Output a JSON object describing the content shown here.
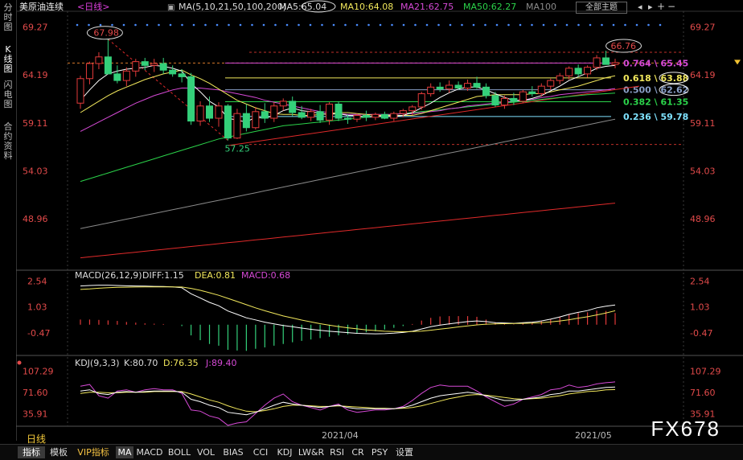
{
  "sidebar": [
    {
      "label": "分时图",
      "active": false
    },
    {
      "label": "K线图",
      "active": true
    },
    {
      "label": "闪电图",
      "active": false
    },
    {
      "label": "合约资料",
      "active": false
    }
  ],
  "header": {
    "title": "美原油连续",
    "period": "<日线>",
    "ma_params": "MA(5,10,21,50,100,200)",
    "ma5": "MA5:65.04",
    "ma10": "MA10:64.08",
    "ma21": "MA21:62.75",
    "ma50": "MA50:62.27",
    "ma100": "MA100",
    "theme_button": "全部主题"
  },
  "colors": {
    "up": "#e23a3a",
    "down": "#34d07a",
    "ma5": "#ffffff",
    "ma10": "#f2e85c",
    "ma21": "#d64ad6",
    "ma50": "#2bd34a",
    "ma100": "#8a8a8a",
    "ma200": "#e02a2a"
  },
  "price_axis": {
    "ticks": [
      "69.27",
      "64.19",
      "59.11",
      "54.03",
      "48.96"
    ]
  },
  "annotations": {
    "high": "67.98",
    "recent_high": "66.76",
    "low": "57.25"
  },
  "fib_levels": [
    {
      "label": "0.764",
      "value": "65.45",
      "color": "#d64ad6"
    },
    {
      "label": "0.618",
      "value": "63.88",
      "color": "#f2e85c"
    },
    {
      "label": "0.500",
      "value": "62.62",
      "color": "#8aa0c8"
    },
    {
      "label": "0.382",
      "value": "61.35",
      "color": "#2bd34a"
    },
    {
      "label": "0.236",
      "value": "59.78",
      "color": "#7fe3ff"
    }
  ],
  "candles": [
    {
      "o": 61.2,
      "h": 64.1,
      "l": 60.6,
      "c": 63.8
    },
    {
      "o": 63.8,
      "h": 65.6,
      "l": 63.2,
      "c": 65.4
    },
    {
      "o": 65.4,
      "h": 66.6,
      "l": 64.8,
      "c": 66.1
    },
    {
      "o": 66.1,
      "h": 67.98,
      "l": 65.2,
      "c": 64.3
    },
    {
      "o": 64.3,
      "h": 65.2,
      "l": 63.3,
      "c": 63.6
    },
    {
      "o": 63.6,
      "h": 65.0,
      "l": 63.0,
      "c": 64.6
    },
    {
      "o": 64.6,
      "h": 65.9,
      "l": 64.0,
      "c": 65.6
    },
    {
      "o": 65.6,
      "h": 66.0,
      "l": 64.7,
      "c": 65.2
    },
    {
      "o": 65.2,
      "h": 65.9,
      "l": 64.5,
      "c": 65.4
    },
    {
      "o": 65.4,
      "h": 66.0,
      "l": 64.3,
      "c": 64.7
    },
    {
      "o": 64.7,
      "h": 65.2,
      "l": 64.0,
      "c": 64.3
    },
    {
      "o": 64.3,
      "h": 64.8,
      "l": 63.4,
      "c": 64.0
    },
    {
      "o": 64.0,
      "h": 64.4,
      "l": 58.9,
      "c": 59.3
    },
    {
      "o": 59.3,
      "h": 61.4,
      "l": 58.8,
      "c": 60.9
    },
    {
      "o": 60.9,
      "h": 61.9,
      "l": 59.2,
      "c": 59.6
    },
    {
      "o": 59.6,
      "h": 61.3,
      "l": 58.7,
      "c": 60.9
    },
    {
      "o": 60.9,
      "h": 61.1,
      "l": 57.25,
      "c": 57.5
    },
    {
      "o": 57.5,
      "h": 60.6,
      "l": 57.4,
      "c": 60.1
    },
    {
      "o": 60.1,
      "h": 61.1,
      "l": 58.2,
      "c": 58.6
    },
    {
      "o": 58.6,
      "h": 60.8,
      "l": 58.4,
      "c": 60.3
    },
    {
      "o": 60.3,
      "h": 61.2,
      "l": 59.1,
      "c": 59.6
    },
    {
      "o": 59.6,
      "h": 61.3,
      "l": 59.2,
      "c": 60.9
    },
    {
      "o": 60.9,
      "h": 61.7,
      "l": 60.4,
      "c": 61.4
    },
    {
      "o": 61.4,
      "h": 61.9,
      "l": 59.8,
      "c": 60.2
    },
    {
      "o": 60.2,
      "h": 60.9,
      "l": 59.5,
      "c": 59.7
    },
    {
      "o": 59.7,
      "h": 60.6,
      "l": 59.3,
      "c": 60.3
    },
    {
      "o": 60.3,
      "h": 61.0,
      "l": 59.1,
      "c": 59.4
    },
    {
      "o": 59.4,
      "h": 61.3,
      "l": 58.9,
      "c": 61.1
    },
    {
      "o": 61.1,
      "h": 61.4,
      "l": 59.3,
      "c": 59.6
    },
    {
      "o": 59.6,
      "h": 60.0,
      "l": 59.0,
      "c": 59.5
    },
    {
      "o": 59.5,
      "h": 60.1,
      "l": 59.2,
      "c": 59.9
    },
    {
      "o": 59.9,
      "h": 60.4,
      "l": 59.3,
      "c": 59.7
    },
    {
      "o": 59.7,
      "h": 60.2,
      "l": 59.4,
      "c": 60.0
    },
    {
      "o": 60.0,
      "h": 60.3,
      "l": 59.5,
      "c": 59.6
    },
    {
      "o": 59.6,
      "h": 60.3,
      "l": 59.3,
      "c": 60.1
    },
    {
      "o": 60.1,
      "h": 60.6,
      "l": 59.7,
      "c": 60.4
    },
    {
      "o": 60.4,
      "h": 61.0,
      "l": 59.9,
      "c": 60.8
    },
    {
      "o": 60.8,
      "h": 62.4,
      "l": 60.5,
      "c": 62.2
    },
    {
      "o": 62.2,
      "h": 63.3,
      "l": 61.9,
      "c": 62.9
    },
    {
      "o": 62.9,
      "h": 63.4,
      "l": 62.4,
      "c": 62.7
    },
    {
      "o": 62.7,
      "h": 63.6,
      "l": 62.3,
      "c": 63.1
    },
    {
      "o": 63.1,
      "h": 63.5,
      "l": 62.6,
      "c": 62.8
    },
    {
      "o": 62.8,
      "h": 63.7,
      "l": 62.5,
      "c": 63.3
    },
    {
      "o": 63.3,
      "h": 64.0,
      "l": 62.7,
      "c": 62.9
    },
    {
      "o": 62.9,
      "h": 63.3,
      "l": 61.7,
      "c": 62.0
    },
    {
      "o": 62.0,
      "h": 62.4,
      "l": 60.8,
      "c": 61.0
    },
    {
      "o": 61.0,
      "h": 62.0,
      "l": 60.6,
      "c": 61.7
    },
    {
      "o": 61.7,
      "h": 62.3,
      "l": 61.0,
      "c": 61.4
    },
    {
      "o": 61.4,
      "h": 62.6,
      "l": 61.2,
      "c": 62.4
    },
    {
      "o": 62.4,
      "h": 63.0,
      "l": 61.9,
      "c": 62.2
    },
    {
      "o": 62.2,
      "h": 63.3,
      "l": 61.9,
      "c": 63.0
    },
    {
      "o": 63.0,
      "h": 63.8,
      "l": 62.6,
      "c": 63.6
    },
    {
      "o": 63.6,
      "h": 64.4,
      "l": 63.2,
      "c": 64.1
    },
    {
      "o": 64.1,
      "h": 65.1,
      "l": 63.7,
      "c": 64.9
    },
    {
      "o": 64.9,
      "h": 65.3,
      "l": 64.0,
      "c": 64.3
    },
    {
      "o": 64.3,
      "h": 65.2,
      "l": 63.9,
      "c": 65.0
    },
    {
      "o": 65.0,
      "h": 66.3,
      "l": 64.7,
      "c": 66.0
    },
    {
      "o": 66.0,
      "h": 66.76,
      "l": 65.6,
      "c": 65.3
    },
    {
      "o": 65.3,
      "h": 65.9,
      "l": 64.9,
      "c": 65.5
    }
  ],
  "ma_lines": {
    "ma5": [
      61.5,
      62.6,
      63.6,
      64.3,
      64.6,
      64.8,
      64.9,
      65.0,
      65.2,
      65.1,
      64.9,
      64.6,
      63.3,
      62.4,
      61.4,
      60.8,
      59.6,
      59.4,
      59.2,
      59.7,
      59.6,
      59.9,
      60.4,
      60.7,
      60.4,
      60.3,
      60.1,
      60.0,
      60.1,
      59.9,
      59.9,
      59.7,
      59.8,
      59.8,
      59.8,
      59.9,
      60.2,
      60.7,
      61.2,
      61.8,
      62.3,
      62.7,
      62.9,
      62.9,
      62.6,
      62.2,
      61.8,
      61.5,
      61.5,
      61.7,
      62.0,
      62.5,
      63.0,
      63.6,
      64.0,
      64.4,
      64.9,
      65.1,
      65.2
    ],
    "ma10": [
      60.2,
      60.8,
      61.4,
      62.0,
      62.5,
      62.9,
      63.3,
      63.7,
      64.0,
      64.3,
      64.5,
      64.7,
      64.2,
      63.8,
      63.3,
      62.7,
      62.1,
      61.5,
      61.1,
      60.7,
      60.4,
      60.1,
      60.0,
      60.0,
      59.9,
      59.9,
      60.0,
      60.1,
      60.2,
      60.2,
      60.1,
      60.0,
      59.9,
      59.9,
      59.9,
      59.9,
      59.9,
      60.1,
      60.4,
      60.7,
      61.0,
      61.3,
      61.6,
      61.9,
      62.0,
      62.1,
      62.1,
      62.1,
      62.1,
      62.2,
      62.2,
      62.4,
      62.6,
      62.8,
      63.0,
      63.3,
      63.6,
      63.9,
      64.1
    ],
    "ma21": [
      58.2,
      58.7,
      59.2,
      59.7,
      60.2,
      60.7,
      61.2,
      61.6,
      62.0,
      62.3,
      62.6,
      62.8,
      62.8,
      62.8,
      62.7,
      62.6,
      62.4,
      62.2,
      62.0,
      61.8,
      61.5,
      61.3,
      61.1,
      60.9,
      60.7,
      60.5,
      60.3,
      60.2,
      60.1,
      60.0,
      60.0,
      60.0,
      60.0,
      60.0,
      60.0,
      60.1,
      60.1,
      60.2,
      60.3,
      60.4,
      60.6,
      60.7,
      60.9,
      61.0,
      61.1,
      61.2,
      61.3,
      61.4,
      61.5,
      61.6,
      61.8,
      61.9,
      62.1,
      62.2,
      62.3,
      62.4,
      62.5,
      62.6,
      62.75
    ],
    "ma50": [
      52.9,
      53.2,
      53.5,
      53.8,
      54.1,
      54.4,
      54.7,
      55.0,
      55.3,
      55.6,
      55.9,
      56.2,
      56.5,
      56.8,
      57.1,
      57.4,
      57.6,
      57.8,
      58.0,
      58.2,
      58.4,
      58.6,
      58.8,
      58.9,
      59.0,
      59.1,
      59.2,
      59.3,
      59.4,
      59.5,
      59.6,
      59.7,
      59.8,
      59.9,
      60.0,
      60.1,
      60.2,
      60.3,
      60.4,
      60.5,
      60.6,
      60.7,
      60.8,
      60.9,
      61.0,
      61.1,
      61.2,
      61.3,
      61.4,
      61.5,
      61.6,
      61.7,
      61.8,
      61.9,
      62.0,
      62.1,
      62.15,
      62.2,
      62.27
    ],
    "ma100": [
      47.9,
      48.1,
      48.3,
      48.5,
      48.7,
      48.9,
      49.1,
      49.3,
      49.5,
      49.7,
      49.9,
      50.1,
      50.3,
      50.5,
      50.7,
      50.9,
      51.1,
      51.3,
      51.5,
      51.7,
      51.9,
      52.1,
      52.3,
      52.5,
      52.7,
      52.9,
      53.1,
      53.3,
      53.5,
      53.7,
      53.9,
      54.1,
      54.3,
      54.5,
      54.7,
      54.9,
      55.1,
      55.3,
      55.5,
      55.7,
      55.9,
      56.1,
      56.3,
      56.5,
      56.7,
      56.9,
      57.1,
      57.3,
      57.5,
      57.7,
      57.9,
      58.1,
      58.3,
      58.5,
      58.7,
      58.9,
      59.1,
      59.3,
      59.5
    ],
    "ma200": [
      44.8,
      44.9,
      45.0,
      45.1,
      45.2,
      45.3,
      45.4,
      45.5,
      45.6,
      45.7,
      45.8,
      45.9,
      46.0,
      46.1,
      46.2,
      46.3,
      46.4,
      46.5,
      46.6,
      46.7,
      46.8,
      46.9,
      47.0,
      47.1,
      47.2,
      47.3,
      47.4,
      47.5,
      47.6,
      47.7,
      47.8,
      47.9,
      48.0,
      48.1,
      48.2,
      48.3,
      48.4,
      48.5,
      48.6,
      48.7,
      48.8,
      48.9,
      49.0,
      49.1,
      49.2,
      49.3,
      49.4,
      49.5,
      49.6,
      49.7,
      49.8,
      49.9,
      50.0,
      50.1,
      50.2,
      50.3,
      50.4,
      50.5,
      50.6
    ]
  },
  "macd": {
    "params": "MACD(26,12,9)",
    "diff": "DIFF:1.15",
    "dea": "DEA:0.81",
    "macd": "MACD:0.68",
    "axis": [
      "2.54",
      "1.03",
      "-0.47"
    ],
    "diff_series": [
      2.25,
      2.28,
      2.3,
      2.3,
      2.28,
      2.26,
      2.25,
      2.24,
      2.23,
      2.22,
      2.2,
      2.15,
      1.8,
      1.55,
      1.3,
      1.1,
      0.8,
      0.6,
      0.4,
      0.28,
      0.15,
      0.05,
      -0.05,
      -0.12,
      -0.2,
      -0.27,
      -0.33,
      -0.38,
      -0.42,
      -0.46,
      -0.5,
      -0.52,
      -0.53,
      -0.52,
      -0.49,
      -0.45,
      -0.38,
      -0.25,
      -0.12,
      -0.02,
      0.05,
      0.12,
      0.18,
      0.22,
      0.18,
      0.12,
      0.1,
      0.08,
      0.12,
      0.15,
      0.22,
      0.32,
      0.45,
      0.6,
      0.72,
      0.82,
      0.98,
      1.08,
      1.15
    ],
    "dea_series": [
      2.05,
      2.08,
      2.12,
      2.15,
      2.17,
      2.18,
      2.19,
      2.2,
      2.2,
      2.2,
      2.2,
      2.19,
      2.11,
      2.0,
      1.86,
      1.71,
      1.53,
      1.35,
      1.16,
      0.98,
      0.81,
      0.66,
      0.51,
      0.39,
      0.27,
      0.16,
      0.06,
      -0.03,
      -0.11,
      -0.18,
      -0.24,
      -0.3,
      -0.34,
      -0.38,
      -0.4,
      -0.41,
      -0.4,
      -0.37,
      -0.32,
      -0.26,
      -0.2,
      -0.13,
      -0.07,
      -0.01,
      0.03,
      0.05,
      0.06,
      0.07,
      0.08,
      0.09,
      0.12,
      0.16,
      0.22,
      0.29,
      0.38,
      0.46,
      0.57,
      0.68,
      0.81
    ],
    "hist": [
      0.3,
      0.3,
      0.28,
      0.25,
      0.22,
      0.16,
      0.12,
      0.08,
      0.06,
      0.04,
      0.0,
      -0.08,
      -0.62,
      -0.9,
      -1.12,
      -1.22,
      -1.46,
      -1.5,
      -1.52,
      -1.4,
      -1.32,
      -1.22,
      -1.12,
      -1.02,
      -0.94,
      -0.86,
      -0.78,
      -0.7,
      -0.62,
      -0.56,
      -0.52,
      -0.44,
      -0.38,
      -0.28,
      -0.18,
      -0.08,
      0.04,
      0.24,
      0.4,
      0.48,
      0.5,
      0.5,
      0.5,
      0.46,
      0.3,
      0.14,
      0.08,
      0.02,
      0.08,
      0.12,
      0.2,
      0.32,
      0.46,
      0.62,
      0.68,
      0.72,
      0.82,
      0.8,
      0.68
    ]
  },
  "kdj": {
    "params": "KDJ(9,3,3)",
    "k": "K:80.70",
    "d": "D:76.35",
    "j": "J:89.40",
    "axis": [
      "107.29",
      "71.60",
      "35.91"
    ],
    "k_series": [
      74,
      76,
      70,
      68,
      72,
      73,
      72,
      73,
      74,
      74,
      74,
      72,
      60,
      56,
      50,
      46,
      38,
      36,
      34,
      38,
      44,
      50,
      55,
      52,
      50,
      48,
      46,
      48,
      50,
      46,
      44,
      44,
      44,
      44,
      44,
      46,
      50,
      56,
      62,
      66,
      68,
      70,
      72,
      70,
      66,
      62,
      58,
      58,
      60,
      62,
      64,
      68,
      70,
      74,
      74,
      76,
      78,
      80,
      80.7
    ],
    "d_series": [
      70,
      72,
      72,
      71,
      71,
      72,
      72,
      72,
      73,
      73,
      73,
      73,
      69,
      64,
      59,
      55,
      49,
      44,
      40,
      39,
      41,
      44,
      48,
      50,
      50,
      49,
      48,
      48,
      49,
      48,
      47,
      46,
      45,
      45,
      44,
      45,
      46,
      49,
      53,
      57,
      61,
      64,
      67,
      68,
      67,
      65,
      63,
      61,
      60,
      61,
      62,
      64,
      66,
      69,
      71,
      73,
      74,
      76,
      76.35
    ],
    "j_series": [
      82,
      85,
      66,
      62,
      74,
      76,
      72,
      76,
      78,
      76,
      76,
      70,
      42,
      40,
      32,
      28,
      16,
      20,
      22,
      36,
      50,
      62,
      69,
      56,
      50,
      46,
      42,
      48,
      52,
      42,
      38,
      40,
      42,
      42,
      44,
      48,
      58,
      70,
      80,
      84,
      82,
      82,
      82,
      74,
      64,
      56,
      48,
      52,
      60,
      64,
      68,
      76,
      78,
      84,
      80,
      82,
      86,
      88,
      89.4
    ]
  },
  "date_labels": [
    "2021/04",
    "2021/05"
  ],
  "period_tab": "日线",
  "bottom_tabs": [
    {
      "label": "指标",
      "active": true
    },
    {
      "label": "模板"
    },
    {
      "label": "VIP指标",
      "vip": true
    },
    {
      "label": "MA",
      "active": true
    },
    {
      "label": "MACD"
    },
    {
      "label": "BOLL"
    },
    {
      "label": "VOL"
    },
    {
      "label": "BIAS"
    },
    {
      "label": "CCI"
    },
    {
      "label": "KDJ"
    },
    {
      "label": "LW&R"
    },
    {
      "label": "RSI"
    },
    {
      "label": "CR"
    },
    {
      "label": "PSY"
    },
    {
      "label": "设置"
    }
  ],
  "watermark": "FX678"
}
